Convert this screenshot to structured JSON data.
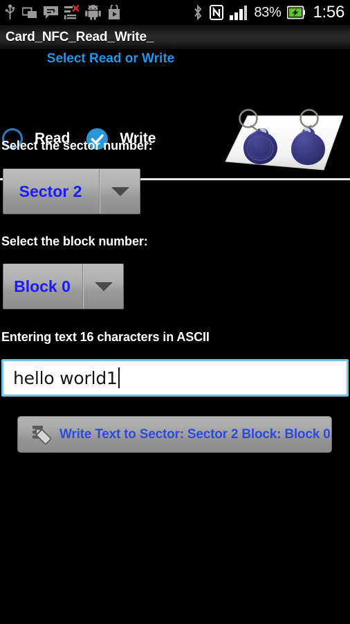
{
  "statusbar": {
    "icons_left": [
      "usb-icon",
      "screen-mirror-icon",
      "sms-message-icon",
      "task-list-error-icon",
      "android-robot-icon",
      "play-store-icon"
    ],
    "icons_right": [
      "bluetooth-icon",
      "nfc-icon",
      "signal-bars-icon",
      "battery-charging-icon"
    ],
    "battery_percent": "83%",
    "clock": "1:56"
  },
  "titlebar": {
    "title": "Card_NFC_Read_Write_"
  },
  "mode_section": {
    "heading": "Select Read or Write",
    "options": [
      {
        "label": "Read",
        "selected": false
      },
      {
        "label": "Write",
        "selected": true
      }
    ],
    "photo_alt": "nfc-key-fobs-photo"
  },
  "sector_section": {
    "label": "Select the sector number:",
    "selected": "Sector 2",
    "arrow_icon": "chevron-down-icon"
  },
  "block_section": {
    "label": "Select the block number:",
    "selected": "Block 0",
    "arrow_icon": "chevron-down-icon"
  },
  "text_section": {
    "label": "Entering text 16 characters in ASCII",
    "value": "hello world1",
    "placeholder": ""
  },
  "write_action": {
    "label": "Write Text to Sector: Sector 2 Block: Block 0",
    "icon": "write-document-pencil-icon"
  },
  "colors": {
    "background": "#000000",
    "accent_blue": "#2196e8",
    "spinner_text_blue": "#1a1aff",
    "button_text_blue": "#2b4be0",
    "input_border": "#79c3e8",
    "divider": "#e9e9e9",
    "radio_selected": "#2b96d4"
  }
}
